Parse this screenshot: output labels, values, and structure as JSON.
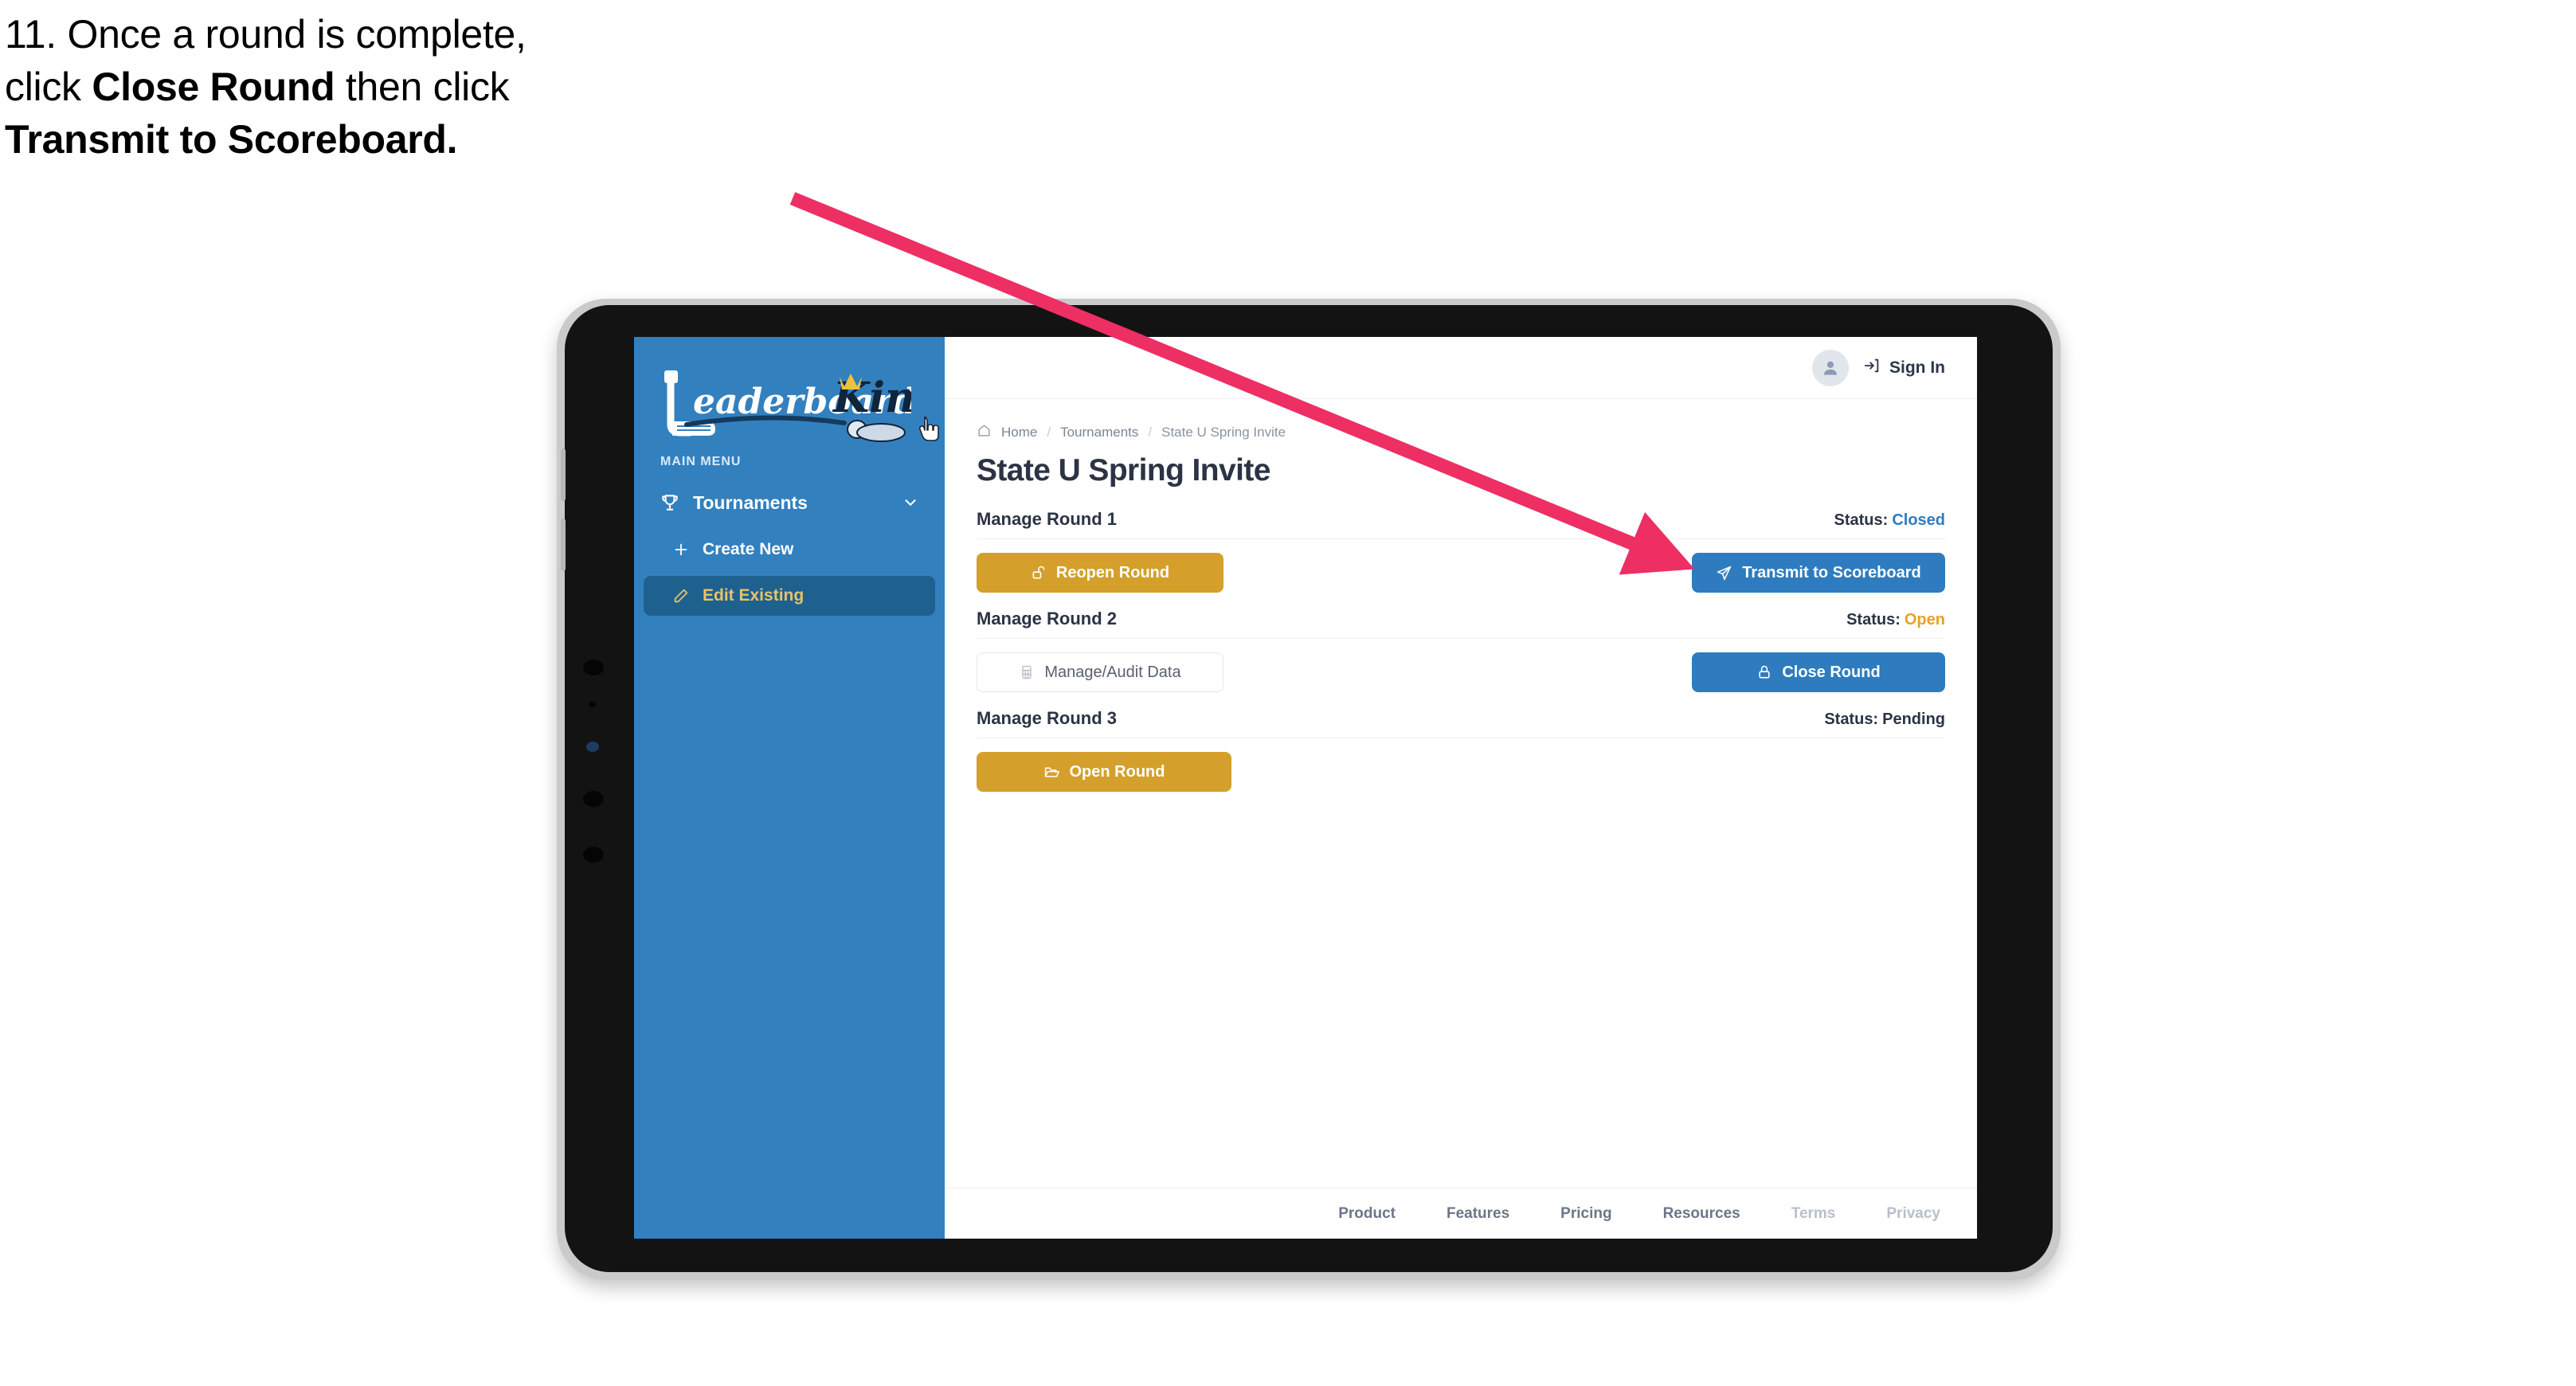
{
  "caption": {
    "line1_prefix": "11. Once a round is complete,",
    "line2_prefix": "click ",
    "line2_bold": "Close Round",
    "line2_suffix": " then click",
    "line3_bold": "Transmit to Scoreboard."
  },
  "annotation": {
    "arrow_color": "#ed2f63",
    "points_to": "Transmit to Scoreboard"
  },
  "app": {
    "sidebar": {
      "logo_primary": "Leaderboard",
      "logo_secondary": "King",
      "menu_label": "MAIN MENU",
      "items": [
        {
          "label": "Tournaments",
          "icon": "trophy-icon",
          "expanded": true
        },
        {
          "label": "Create New",
          "icon": "plus-icon",
          "active": false
        },
        {
          "label": "Edit Existing",
          "icon": "pencil-square-icon",
          "active": true
        }
      ],
      "colors": {
        "background": "#3380BF",
        "active_background": "#1E618F",
        "active_text": "#E7C36A"
      }
    },
    "topbar": {
      "avatar_icon": "user-avatar-icon",
      "signin_icon": "sign-in-icon",
      "signin_label": "Sign In"
    },
    "breadcrumb": {
      "home_icon": "home-icon",
      "items": [
        "Home",
        "Tournaments",
        "State U Spring Invite"
      ],
      "separator": "/"
    },
    "page_title": "State U Spring Invite",
    "rounds": [
      {
        "title": "Manage Round 1",
        "status_label": "Status:",
        "status_value": "Closed",
        "status_color": "#2E7CBF",
        "left_button": {
          "label": "Reopen Round",
          "icon": "unlock-icon",
          "style": "gold"
        },
        "right_button": {
          "label": "Transmit to Scoreboard",
          "icon": "paper-plane-icon",
          "style": "blue"
        }
      },
      {
        "title": "Manage Round 2",
        "status_label": "Status:",
        "status_value": "Open",
        "status_color": "#E3A326",
        "left_button": {
          "label": "Manage/Audit Data",
          "icon": "table-grid-icon",
          "style": "ghost"
        },
        "right_button": {
          "label": "Close Round",
          "icon": "lock-icon",
          "style": "blue"
        }
      },
      {
        "title": "Manage Round 3",
        "status_label": "Status:",
        "status_value": "Pending",
        "status_color": "#2B3344",
        "left_button": {
          "label": "Open Round",
          "icon": "folder-open-icon",
          "style": "gold"
        },
        "right_button": null
      }
    ],
    "footer": {
      "links": [
        {
          "label": "Product",
          "muted": false
        },
        {
          "label": "Features",
          "muted": false
        },
        {
          "label": "Pricing",
          "muted": false
        },
        {
          "label": "Resources",
          "muted": false
        },
        {
          "label": "Terms",
          "muted": true
        },
        {
          "label": "Privacy",
          "muted": true
        }
      ]
    }
  }
}
